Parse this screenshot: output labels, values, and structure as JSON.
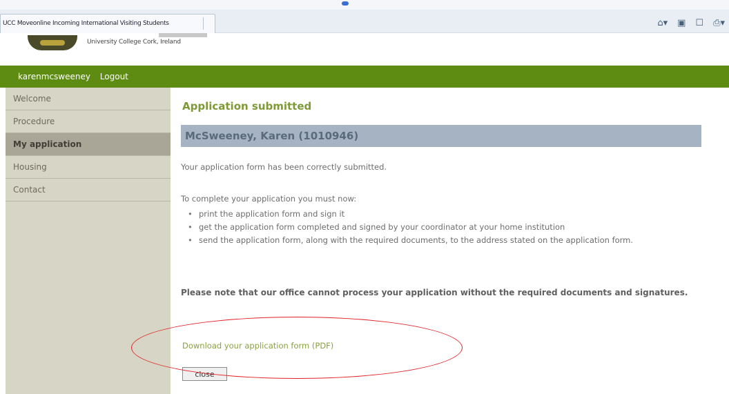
{
  "browser": {
    "tab_title": "UCC Moveonline Incoming International Visiting Students"
  },
  "site": {
    "university": "University College Cork, Ireland"
  },
  "userbar": {
    "username": "karenmcsweeney",
    "logout": "Logout"
  },
  "sidebar": {
    "items": [
      {
        "label": "Welcome"
      },
      {
        "label": "Procedure"
      },
      {
        "label": "My application"
      },
      {
        "label": "Housing"
      },
      {
        "label": "Contact"
      }
    ],
    "active": "My application"
  },
  "main": {
    "title": "Application submitted",
    "applicant": "McSweeney, Karen (1010946)",
    "confirmation": "Your application form has been correctly submitted.",
    "instructions_intro": "To complete your application you must now:",
    "steps": [
      "print the application form and sign it",
      "get the application form completed and signed by your coordinator at your home institution",
      "send the application form, along with the required documents, to the address stated on the application form."
    ],
    "note": "Please note that our office cannot process your application without the required documents and signatures.",
    "download_link": "Download your application form (PDF)",
    "close_label": "close"
  },
  "colors": {
    "green_bar": "#5e8c12",
    "title_green": "#7e9a35",
    "name_bar": "#a5b3c2",
    "sidebar": "#d7d6c6",
    "annotation": "#e31e24"
  }
}
